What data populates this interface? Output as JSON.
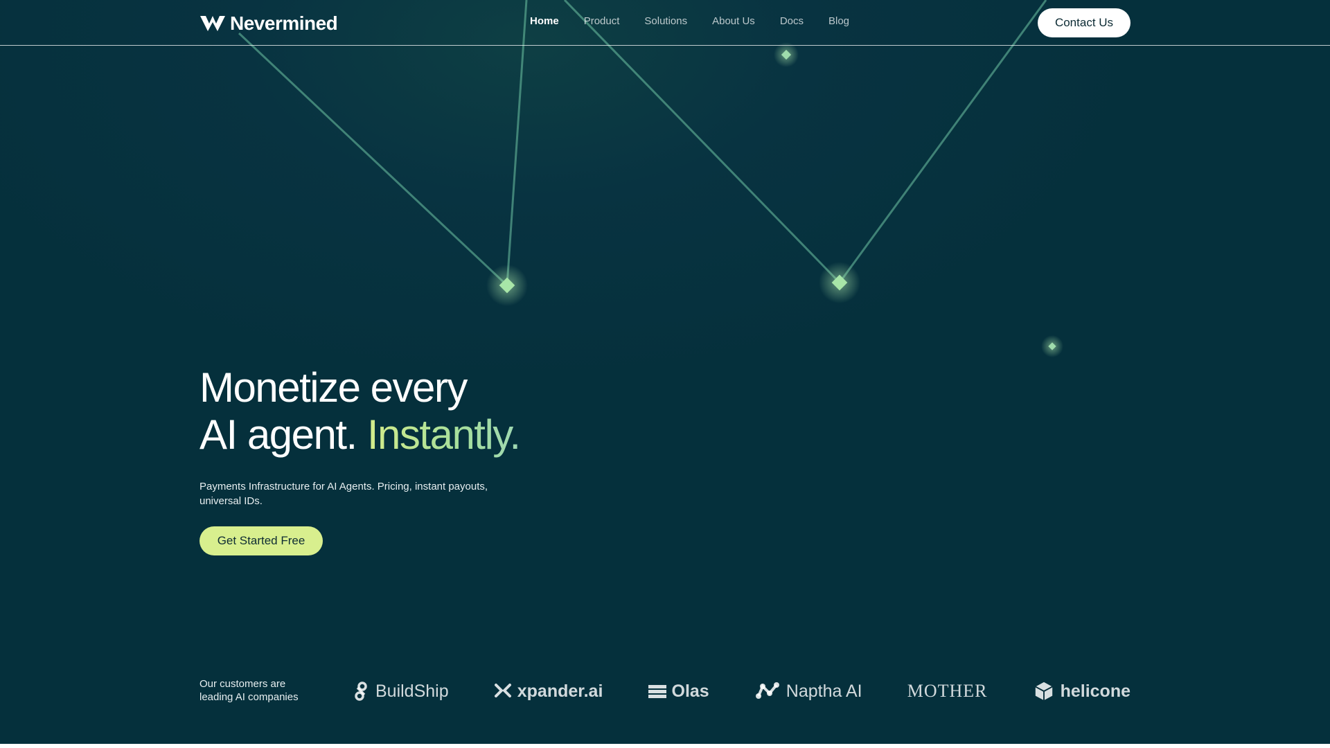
{
  "brand": {
    "name": "Nevermined",
    "logo_icon": "nevermined-logo-icon"
  },
  "nav": {
    "items": [
      {
        "label": "Home",
        "active": true
      },
      {
        "label": "Product",
        "active": false
      },
      {
        "label": "Solutions",
        "active": false
      },
      {
        "label": "About Us",
        "active": false
      },
      {
        "label": "Docs",
        "active": false
      },
      {
        "label": "Blog",
        "active": false
      }
    ],
    "contact_label": "Contact Us"
  },
  "hero": {
    "title_line1": "Monetize every",
    "title_line2": "AI agent.",
    "title_accent": "Instantly.",
    "subtitle": "Payments Infrastructure for AI Agents. Pricing, instant payouts, universal IDs.",
    "cta_label": "Get Started Free"
  },
  "customers": {
    "label_line1": "Our customers are",
    "label_line2": "leading AI companies",
    "logos": [
      {
        "name": "BuildShip",
        "icon": "buildship-icon"
      },
      {
        "name": "xpander.ai",
        "icon": "xpander-icon"
      },
      {
        "name": "Olas",
        "icon": "olas-icon"
      },
      {
        "name": "Naptha AI",
        "icon": "naptha-icon"
      },
      {
        "name": "MOTHER",
        "icon": ""
      },
      {
        "name": "helicone",
        "icon": "helicone-icon"
      }
    ]
  },
  "colors": {
    "background": "#062d3a",
    "accent": "#d8ef8e",
    "line": "#7ed0a8",
    "node": "#a8e6a8"
  }
}
